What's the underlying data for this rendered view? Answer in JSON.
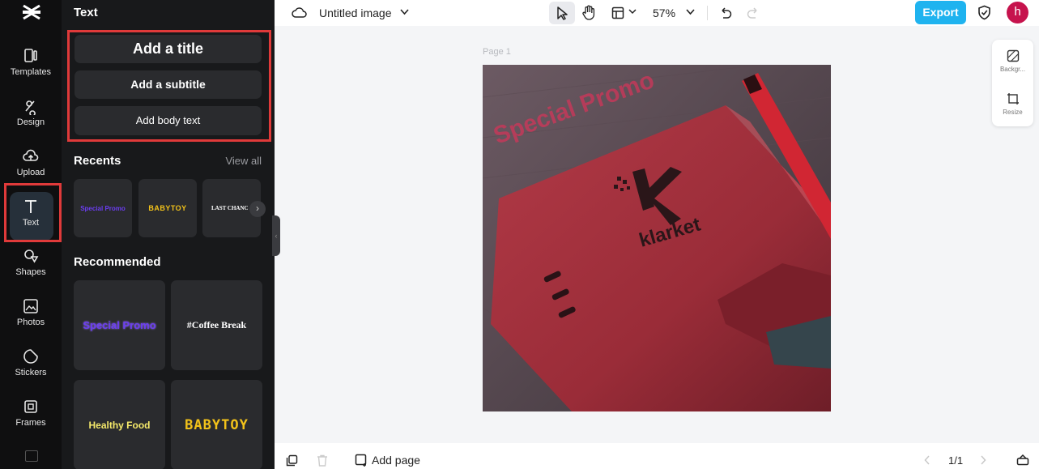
{
  "rail": {
    "items": [
      {
        "label": "Templates"
      },
      {
        "label": "Design"
      },
      {
        "label": "Upload"
      },
      {
        "label": "Text"
      },
      {
        "label": "Shapes"
      },
      {
        "label": "Photos"
      },
      {
        "label": "Stickers"
      },
      {
        "label": "Frames"
      }
    ],
    "active": "Text"
  },
  "panel": {
    "title": "Text",
    "add_title": "Add a title",
    "add_subtitle": "Add a subtitle",
    "add_body": "Add body text",
    "recents_title": "Recents",
    "view_all": "View all",
    "recents": [
      "Special Promo",
      "BABYTOY",
      "LAST CHANC"
    ],
    "recommended_title": "Recommended",
    "recommended": [
      "Special Promo",
      "#Coffee Break",
      "Healthy Food",
      "BABYTOY"
    ]
  },
  "topbar": {
    "doc_title": "Untitled image",
    "zoom": "57%",
    "export_label": "Export",
    "avatar_letter": "h"
  },
  "canvas": {
    "page_label": "Page 1",
    "promo_text": "Special Promo",
    "brand_text": "klarket",
    "brand_letter": "K"
  },
  "side_tools": {
    "background_label": "Backgr...",
    "resize_label": "Resize"
  },
  "bottombar": {
    "add_page_label": "Add page",
    "page_counter": "1/1"
  },
  "colors": {
    "accent": "#1fb3ef",
    "highlight": "#e03a3a",
    "avatar": "#c6134d",
    "panel_bg": "#18191b",
    "rail_bg": "#0f0f10"
  }
}
